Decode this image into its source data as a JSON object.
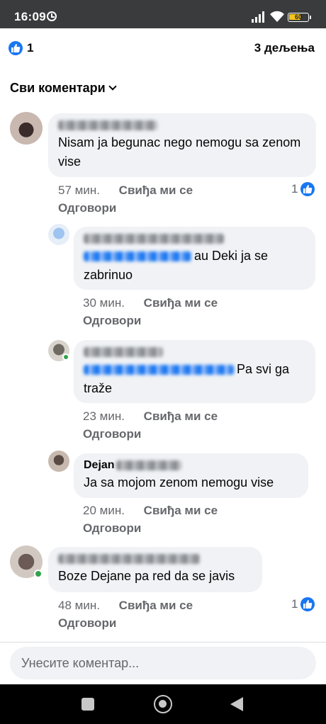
{
  "status_bar": {
    "time": "16:09",
    "battery": "60"
  },
  "post": {
    "reaction_count": "1",
    "shares": "3 дељења"
  },
  "filter": {
    "label": "Сви коментари"
  },
  "comments": [
    {
      "text": "Nisam ja begunac nego nemogu sa zenom vise",
      "time": "57 мин.",
      "like": "Свиђа ми се",
      "reply": "Одговори",
      "reactions": "1"
    },
    {
      "text": "au Deki ja se zabrinuo",
      "time": "30 мин.",
      "like": "Свиђа ми се",
      "reply": "Одговори"
    },
    {
      "text": "Pa svi ga traže",
      "time": "23 мин.",
      "like": "Свиђа ми се",
      "reply": "Одговори"
    },
    {
      "author": "Dejan",
      "text": "Ja sa mojom zenom nemogu vise",
      "time": "20 мин.",
      "like": "Свиђа ми се",
      "reply": "Одговори"
    },
    {
      "text": "Boze Dejane pa red da se javis",
      "time": "48 мин.",
      "like": "Свиђа ми се",
      "reply": "Одговори",
      "reactions": "1"
    }
  ],
  "composer": {
    "placeholder": "Унесите коментар..."
  },
  "icons": {
    "like": "thumbs-up-icon",
    "alarm": "alarm-clock-icon",
    "wifi": "wifi-icon",
    "signal": "signal-icon",
    "battery": "battery-icon",
    "chevron": "chevron-down-icon"
  },
  "colors": {
    "accent": "#1877f2",
    "bubble": "#f0f2f5",
    "meta": "#65676b",
    "status_bar": "#3a3b3c"
  }
}
